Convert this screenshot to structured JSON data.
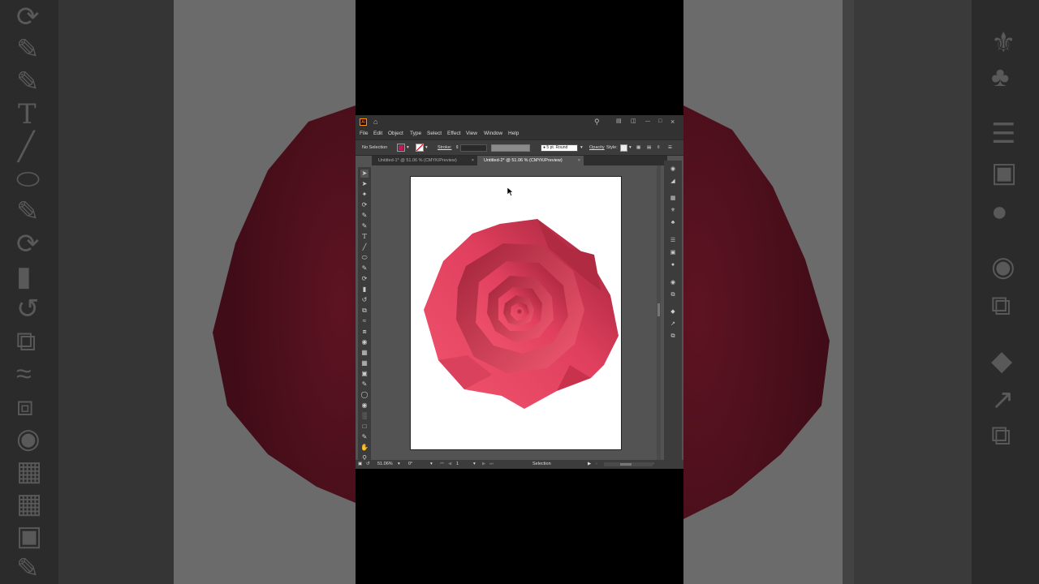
{
  "app": {
    "window_controls": {
      "minimize": "—",
      "maximize": "□",
      "close": "×"
    },
    "menu": [
      "File",
      "Edit",
      "Object",
      "Type",
      "Select",
      "Effect",
      "View",
      "Window",
      "Help"
    ],
    "control_bar": {
      "selection_label": "No Selection",
      "stroke_label": "Stroke:",
      "brush_label": "5 pt. Round",
      "opacity_label": "Opacity",
      "style_label": "Style:"
    },
    "tabs": [
      {
        "label": "Untitled-1* @ 51.06 % (CMYK/Preview)",
        "active": false
      },
      {
        "label": "Untitled-2* @ 51.06 % (CMYK/Preview)",
        "active": true
      }
    ],
    "tab_close": "×",
    "status": {
      "zoom": "51.06%",
      "rotation": "0°",
      "artboard_number": "1",
      "tool_name": "Selection"
    }
  },
  "colors": {
    "rose_light": "#f2546d",
    "rose_dark": "#9b2035",
    "fill_swatch": "#c2185b",
    "accent": "#ff9a00"
  },
  "icons": {
    "left_tools": [
      "selection-tool",
      "direct-selection-tool",
      "magic-wand-tool",
      "lasso-tool",
      "pen-tool",
      "curvature-tool",
      "type-tool",
      "line-tool",
      "ellipse-tool",
      "paintbrush-tool",
      "shaper-tool",
      "eraser-tool",
      "rotate-tool",
      "scale-tool",
      "warp-tool",
      "free-transform-tool",
      "shape-builder-tool",
      "perspective-grid-tool",
      "mesh-tool",
      "gradient-tool",
      "eyedropper-tool",
      "blend-tool",
      "symbol-sprayer-tool",
      "column-graph-tool",
      "artboard-tool",
      "slice-tool",
      "hand-tool",
      "zoom-tool"
    ],
    "right_panels": [
      "color-panel",
      "color-guide-panel",
      "swatches-panel",
      "brushes-panel",
      "symbols-panel",
      "stroke-panel",
      "gradient-panel",
      "transparency-panel",
      "appearance-panel",
      "graphic-styles-panel",
      "layers-panel",
      "asset-export-panel",
      "artboards-panel"
    ]
  }
}
